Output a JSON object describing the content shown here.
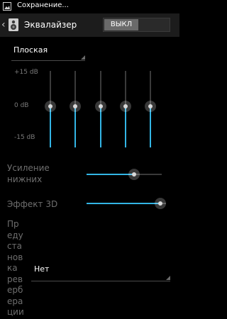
{
  "status_bar": {
    "notification": "Сохранение..."
  },
  "action_bar": {
    "title": "Эквалайзер",
    "toggle_label": "ВЫКЛ"
  },
  "preset": {
    "selected": "Плоская"
  },
  "db_scale": {
    "top": "+15 dB",
    "middle": "0 dB",
    "bottom": "-15 dB"
  },
  "bands": [
    {
      "level_db": 0
    },
    {
      "level_db": 0
    },
    {
      "level_db": 0
    },
    {
      "level_db": 0
    },
    {
      "level_db": 0
    }
  ],
  "bass_boost": {
    "label": "Усиление нижних",
    "level": 0.65
  },
  "effect_3d": {
    "label": "Эффект 3D",
    "level": 1.0
  },
  "reverb": {
    "label": "Предустановка реверберации",
    "selected": "Нет"
  },
  "colors": {
    "accent": "#33b5e5",
    "background": "#000000",
    "action_bar": "#1c1c1c",
    "disabled_text": "#6e6e6e"
  }
}
